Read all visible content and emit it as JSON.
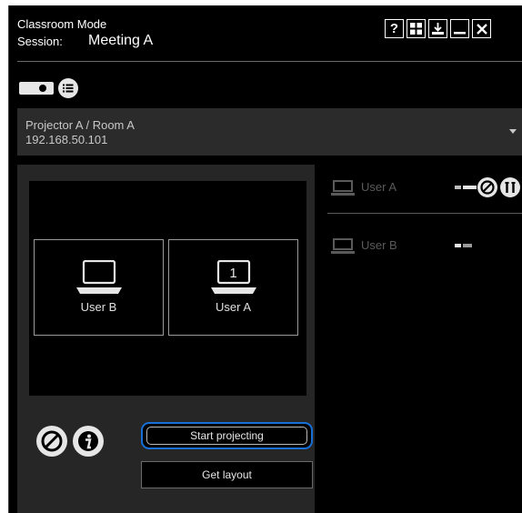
{
  "window": {
    "title": "Classroom Mode",
    "session_label": "Session:",
    "session_name": "Meeting A"
  },
  "title_buttons": [
    {
      "name": "help",
      "icon": "question-icon",
      "glyph": "?"
    },
    {
      "name": "grid",
      "icon": "grid-icon"
    },
    {
      "name": "download",
      "icon": "download-icon"
    },
    {
      "name": "minimize",
      "icon": "minimize-icon"
    },
    {
      "name": "close",
      "icon": "close-icon"
    }
  ],
  "projector": {
    "icons": [
      "projector-icon",
      "list-icon"
    ],
    "name_line": "Projector A / Room A",
    "ip": "192.168.50.101"
  },
  "layout": {
    "slots": [
      {
        "label": "User B",
        "number": ""
      },
      {
        "label": "User A",
        "number": "1"
      }
    ]
  },
  "buttons": {
    "start_projecting": "Start projecting",
    "get_layout": "Get layout"
  },
  "users": [
    {
      "name": "User A",
      "status_icons": [
        "signal-icon",
        "prohibit-icon",
        "tools-icon"
      ]
    },
    {
      "name": "User B",
      "status_icons": [
        "signal-icon"
      ]
    }
  ],
  "colors": {
    "background": "#000000",
    "dropdown": "#2b2b2b",
    "panel": "#262626",
    "focus_ring": "#1670d8",
    "muted_text": "#5a5a5a"
  }
}
